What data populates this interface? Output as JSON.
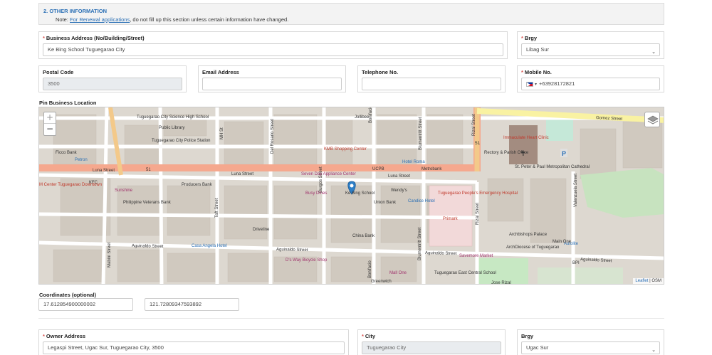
{
  "section": {
    "title": "2. OTHER INFORMATION",
    "note_prefix": "Note: ",
    "note_link": "For Renewal applications",
    "note_suffix": ", do not fill up this section unless certain information have changed."
  },
  "business": {
    "address_label": "Business Address (No/Building/Street)",
    "address_value": "Ke Bing School Tuguegarao City",
    "brgy_label": "Brgy",
    "brgy_value": "Libag Sur",
    "postal_label": "Postal Code",
    "postal_value": "3500",
    "email_label": "Email Address",
    "email_value": "",
    "phone_label": "Telephone No.",
    "phone_value": "",
    "mobile_label": "Mobile No.",
    "mobile_value": "+63928172821"
  },
  "map": {
    "label": "Pin Business Location",
    "zoom_in": "+",
    "zoom_out": "−",
    "attribution_link": "Leaflet",
    "attribution_sep": " | ",
    "attribution_osm": "OSM",
    "street_labels": {
      "luna1": "Luna Street",
      "luna2": "Luna Street",
      "luna3": "Luna Street",
      "gomez": "Gomez Street",
      "aguinaldo1": "Aguinaldo Street",
      "aguinaldo2": "Aguinaldo Street",
      "aguinaldo3": "Aguinaldo Street",
      "aguinaldo4": "Aguinaldo Street",
      "rizal1": "Rizal Street",
      "rizal2": "Rizal Street",
      "burgos": "Burgos Street",
      "delrosario": "Del Rosario Street",
      "blumentritt1": "Blumentritt Street",
      "blumentritt2": "Blumentritt Street",
      "taft": "Taft Street",
      "mabini": "Mabini Street",
      "bonifacio1": "Bonifacio",
      "bonifacio2": "Bonifacio",
      "valenzuela": "Valenzuela Street",
      "mh": "MH St",
      "route51a": "51",
      "route51b": "51",
      "route51c": "51",
      "driveline": "Driveline"
    },
    "poi_labels": {
      "kebing": "Ke Bing School",
      "immaculate": "Immaculate Heart Clinic",
      "rectory": "Rectory & Parish Office",
      "cathedral": "St. Peter & Paul Metropolitan Cathedral",
      "tuguegarao_hospital": "Tuguegarao People's Emergency Hospital",
      "primark": "Primark",
      "archbishops": "Archbishops Palace",
      "archdiocese": "ArchDiocese of Tuguegarao",
      "mall": "Mall One",
      "fast_central": "Tuguegarao East Central School",
      "jose_rizal": "Jose Rizal",
      "kfc": "KFC",
      "philippine_veterans": "Philippine Veterans Bank",
      "producers_bank": "Producers Bank",
      "public_library": "Public Library",
      "city_police": "Tuguegarao City Police Station",
      "science_high": "Tuguegarao City Science High School",
      "casa_angela": "Casa Angela Hotel",
      "ds_way": "D's Way Bicycle Shop",
      "metrobank": "Metrobank",
      "union_bank": "Union Bank",
      "china_bank": "China Bank",
      "candice": "Candice Hotel",
      "savemore": "Savemore Market",
      "mcenter": "M Center Tuguegarao Downtown",
      "petron": "Petron",
      "ficco": "Ficco Bank",
      "hotel_roma": "Hotel Roma",
      "wendys": "Wendy's",
      "jollibee": "Jollibee",
      "greenwich": "Greenwich",
      "bpi": "BPI",
      "autolite": "Autolite",
      "main_one": "Main One",
      "kmb": "KMB Shopping Center",
      "ucpb": "UCPB",
      "sunshine": "Sunshine",
      "busy_dines": "Busy Dines",
      "sevenday": "Seven Day Appliance Center"
    }
  },
  "coordinates": {
    "label": "Coordinates (optional)",
    "lat": "17.612854900000002",
    "lng": "121.72809347593892"
  },
  "owner": {
    "address_label": "Owner Address",
    "address_value": "Legaspi Street, Ugac Sur, Tuguegarao City, 3500",
    "city_label": "City",
    "city_value": "Tuguegarao City",
    "brgy_label": "Brgy",
    "brgy_value": "Ugac Sur"
  }
}
